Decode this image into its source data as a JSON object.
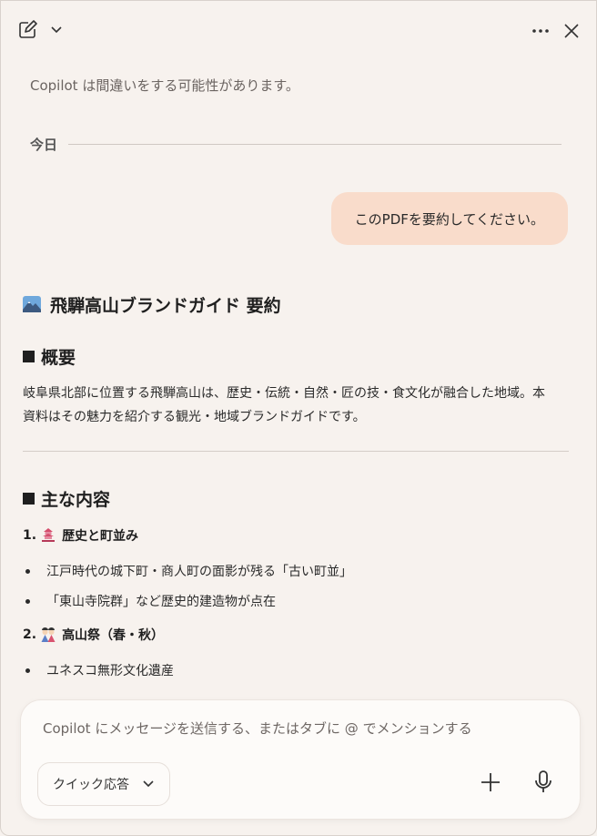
{
  "header": {
    "new_chat_icon": "compose-icon",
    "dropdown_icon": "chevron-down-icon",
    "more_icon": "more-horizontal-icon",
    "close_icon": "close-icon"
  },
  "disclaimer": "Copilot は間違いをする可能性があります。",
  "date_divider": "今日",
  "user_message": "このPDFを要約してください。",
  "answer": {
    "title": "飛騨高山ブランドガイド 要約",
    "section1": {
      "heading": "概要",
      "text_line1": "岐阜県北部に位置する飛騨高山は、歴史・伝統・自然・匠の技・食文化が融合した地域。本",
      "text_line2": "資料はその魅力を紹介する観光・地域ブランドガイドです。"
    },
    "section2": {
      "heading": "主な内容",
      "items": [
        {
          "number": "1.",
          "label": "歴史と町並み",
          "bullets": [
            "江戸時代の城下町・商人町の面影が残る「古い町並」",
            "「東山寺院群」など歴史的建造物が点在"
          ]
        },
        {
          "number": "2.",
          "label": "高山祭（春・秋）",
          "bullets": [
            "ユネスコ無形文化遺産"
          ]
        }
      ]
    }
  },
  "composer": {
    "placeholder": "Copilot にメッセージを送信する、またはタブに @ でメンションする",
    "mode_label": "クイック応答"
  },
  "colors": {
    "background": "#f7f2ee",
    "user_bubble": "#f9dccb",
    "composer": "#fdfbf9"
  }
}
